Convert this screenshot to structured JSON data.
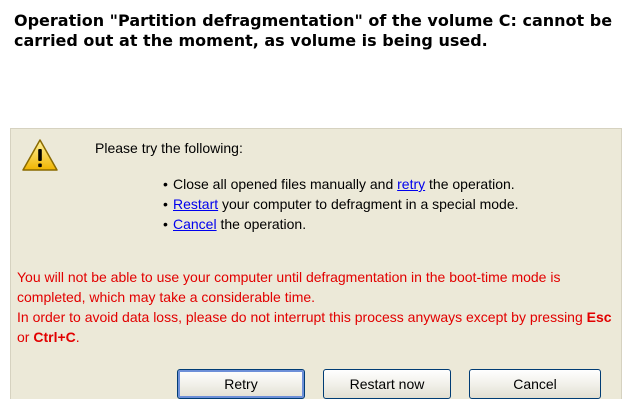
{
  "header": {
    "message": "Operation \"Partition defragmentation\" of the volume C: cannot be carried out at the moment, as volume is being used."
  },
  "dialog": {
    "icon": "warning-icon",
    "lead": "Please try the following:",
    "options": [
      {
        "pre": "",
        "link": "",
        "post": "Close all opened files manually and ",
        "link2": "retry",
        "post2": " the operation."
      },
      {
        "pre": "",
        "link": "Restart",
        "post": " your computer to defragment in a special mode."
      },
      {
        "pre": "",
        "link": "Cancel",
        "post": " the operation."
      }
    ],
    "warning": {
      "line1": "You will not be able to use your computer until defragmentation in the boot-time mode is completed, which may take a considerable time.",
      "line2_prefix": "In order to avoid data loss, please do not interrupt this process anyways except by pressing ",
      "key1": "Esc",
      "or_text": " or ",
      "key2": "Ctrl+C",
      "end": "."
    },
    "buttons": {
      "retry": "Retry",
      "restart": "Restart now",
      "cancel": "Cancel"
    }
  },
  "colors": {
    "panel_bg": "#ece9d8",
    "warning_text": "#e20000",
    "link": "#0000ee"
  }
}
